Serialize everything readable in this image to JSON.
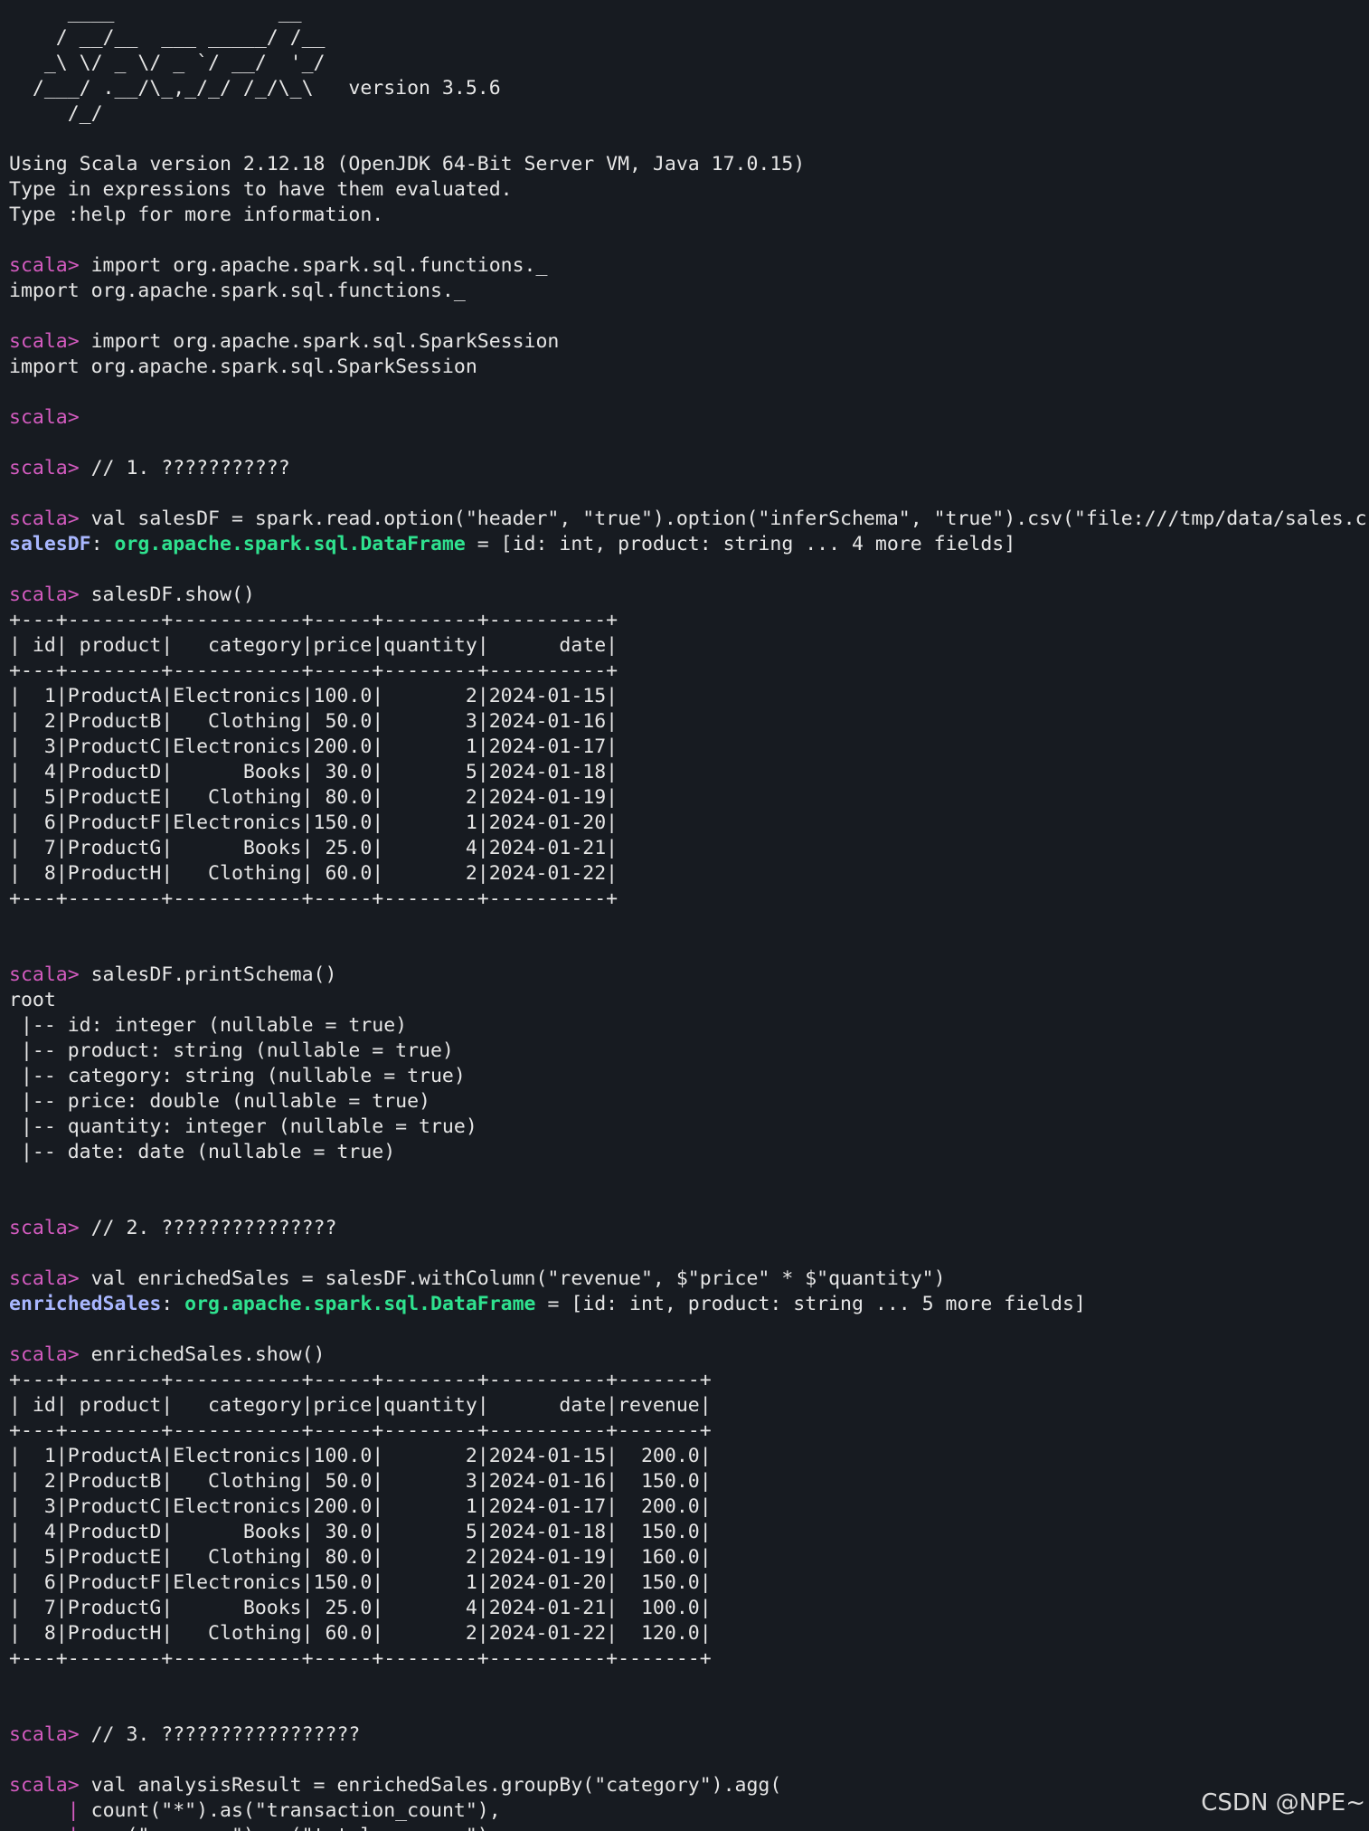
{
  "terminal": {
    "prompt": "scala>",
    "continuation": "|",
    "lines": [
      {
        "kind": "plain",
        "text": "     ____              __"
      },
      {
        "kind": "plain",
        "text": "    / __/__  ___ _____/ /__"
      },
      {
        "kind": "plain",
        "text": "   _\\ \\/ _ \\/ _ `/ __/  '_/"
      },
      {
        "kind": "plain",
        "text": "  /___/ .__/\\_,_/_/ /_/\\_\\   version 3.5.6"
      },
      {
        "kind": "plain",
        "text": "     /_/"
      },
      {
        "kind": "blank"
      },
      {
        "kind": "plain",
        "text": "Using Scala version 2.12.18 (OpenJDK 64-Bit Server VM, Java 17.0.15)"
      },
      {
        "kind": "plain",
        "text": "Type in expressions to have them evaluated."
      },
      {
        "kind": "plain",
        "text": "Type :help for more information."
      },
      {
        "kind": "blank"
      },
      {
        "kind": "input",
        "text": " import org.apache.spark.sql.functions._"
      },
      {
        "kind": "plain",
        "text": "import org.apache.spark.sql.functions._"
      },
      {
        "kind": "blank"
      },
      {
        "kind": "input",
        "text": " import org.apache.spark.sql.SparkSession"
      },
      {
        "kind": "plain",
        "text": "import org.apache.spark.sql.SparkSession"
      },
      {
        "kind": "blank"
      },
      {
        "kind": "input",
        "text": ""
      },
      {
        "kind": "blank"
      },
      {
        "kind": "input",
        "text": " // 1. ???????????"
      },
      {
        "kind": "blank"
      },
      {
        "kind": "input",
        "text": " val salesDF = spark.read.option(\"header\", \"true\").option(\"inferSchema\", \"true\").csv(\"file:///tmp/data/sales.csv\")"
      },
      {
        "kind": "result",
        "name": "salesDF",
        "type": "org.apache.spark.sql.DataFrame",
        "rest": " = [id: int, product: string ... 4 more fields]"
      },
      {
        "kind": "blank"
      },
      {
        "kind": "input",
        "text": " salesDF.show()"
      },
      {
        "kind": "plain",
        "text": "+---+--------+-----------+-----+--------+----------+"
      },
      {
        "kind": "plain",
        "text": "| id| product|   category|price|quantity|      date|"
      },
      {
        "kind": "plain",
        "text": "+---+--------+-----------+-----+--------+----------+"
      },
      {
        "kind": "plain",
        "text": "|  1|ProductA|Electronics|100.0|       2|2024-01-15|"
      },
      {
        "kind": "plain",
        "text": "|  2|ProductB|   Clothing| 50.0|       3|2024-01-16|"
      },
      {
        "kind": "plain",
        "text": "|  3|ProductC|Electronics|200.0|       1|2024-01-17|"
      },
      {
        "kind": "plain",
        "text": "|  4|ProductD|      Books| 30.0|       5|2024-01-18|"
      },
      {
        "kind": "plain",
        "text": "|  5|ProductE|   Clothing| 80.0|       2|2024-01-19|"
      },
      {
        "kind": "plain",
        "text": "|  6|ProductF|Electronics|150.0|       1|2024-01-20|"
      },
      {
        "kind": "plain",
        "text": "|  7|ProductG|      Books| 25.0|       4|2024-01-21|"
      },
      {
        "kind": "plain",
        "text": "|  8|ProductH|   Clothing| 60.0|       2|2024-01-22|"
      },
      {
        "kind": "plain",
        "text": "+---+--------+-----------+-----+--------+----------+"
      },
      {
        "kind": "blank"
      },
      {
        "kind": "blank"
      },
      {
        "kind": "input",
        "text": " salesDF.printSchema()"
      },
      {
        "kind": "plain",
        "text": "root"
      },
      {
        "kind": "plain",
        "text": " |-- id: integer (nullable = true)"
      },
      {
        "kind": "plain",
        "text": " |-- product: string (nullable = true)"
      },
      {
        "kind": "plain",
        "text": " |-- category: string (nullable = true)"
      },
      {
        "kind": "plain",
        "text": " |-- price: double (nullable = true)"
      },
      {
        "kind": "plain",
        "text": " |-- quantity: integer (nullable = true)"
      },
      {
        "kind": "plain",
        "text": " |-- date: date (nullable = true)"
      },
      {
        "kind": "blank"
      },
      {
        "kind": "blank"
      },
      {
        "kind": "input",
        "text": " // 2. ???????????????"
      },
      {
        "kind": "blank"
      },
      {
        "kind": "input",
        "text": " val enrichedSales = salesDF.withColumn(\"revenue\", $\"price\" * $\"quantity\")"
      },
      {
        "kind": "result",
        "name": "enrichedSales",
        "type": "org.apache.spark.sql.DataFrame",
        "rest": " = [id: int, product: string ... 5 more fields]"
      },
      {
        "kind": "blank"
      },
      {
        "kind": "input",
        "text": " enrichedSales.show()"
      },
      {
        "kind": "plain",
        "text": "+---+--------+-----------+-----+--------+----------+-------+"
      },
      {
        "kind": "plain",
        "text": "| id| product|   category|price|quantity|      date|revenue|"
      },
      {
        "kind": "plain",
        "text": "+---+--------+-----------+-----+--------+----------+-------+"
      },
      {
        "kind": "plain",
        "text": "|  1|ProductA|Electronics|100.0|       2|2024-01-15|  200.0|"
      },
      {
        "kind": "plain",
        "text": "|  2|ProductB|   Clothing| 50.0|       3|2024-01-16|  150.0|"
      },
      {
        "kind": "plain",
        "text": "|  3|ProductC|Electronics|200.0|       1|2024-01-17|  200.0|"
      },
      {
        "kind": "plain",
        "text": "|  4|ProductD|      Books| 30.0|       5|2024-01-18|  150.0|"
      },
      {
        "kind": "plain",
        "text": "|  5|ProductE|   Clothing| 80.0|       2|2024-01-19|  160.0|"
      },
      {
        "kind": "plain",
        "text": "|  6|ProductF|Electronics|150.0|       1|2024-01-20|  150.0|"
      },
      {
        "kind": "plain",
        "text": "|  7|ProductG|      Books| 25.0|       4|2024-01-21|  100.0|"
      },
      {
        "kind": "plain",
        "text": "|  8|ProductH|   Clothing| 60.0|       2|2024-01-22|  120.0|"
      },
      {
        "kind": "plain",
        "text": "+---+--------+-----------+-----+--------+----------+-------+"
      },
      {
        "kind": "blank"
      },
      {
        "kind": "blank"
      },
      {
        "kind": "input",
        "text": " // 3. ?????????????????"
      },
      {
        "kind": "blank"
      },
      {
        "kind": "input",
        "text": " val analysisResult = enrichedSales.groupBy(\"category\").agg("
      },
      {
        "kind": "continuation",
        "text": " count(\"*\").as(\"transaction_count\"),"
      },
      {
        "kind": "continuation",
        "text": " sum(\"revenue\").as(\"total_revenue\"),"
      }
    ]
  },
  "watermark": "CSDN @NPE~",
  "colors": {
    "background": "#171b21",
    "text": "#e6e6e6",
    "prompt": "#d35bbf",
    "result_name": "#a9b7ff",
    "result_type": "#2fe28f"
  }
}
